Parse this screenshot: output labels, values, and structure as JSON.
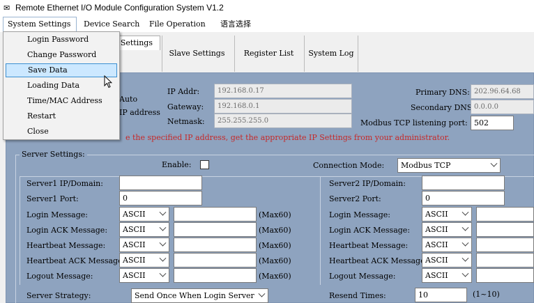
{
  "window": {
    "app_icon": "app-logo-icon",
    "title": "Remote Ethernet I/O Module Configuration System V1.2"
  },
  "menubar": {
    "items": [
      "System Settings",
      "Device Search",
      "File Operation",
      "语言选择"
    ]
  },
  "dropdown": {
    "items": [
      "Login Password",
      "Change Password",
      "Save Data",
      "Loading Data",
      "Time/MAC Address",
      "Restart",
      "Close"
    ],
    "highlighted": "Save Data"
  },
  "tabs": {
    "items": [
      "Settings",
      "Slave Settings",
      "Register List",
      "System Log"
    ],
    "selected": "Settings"
  },
  "network": {
    "ip_mode_auto": "Auto",
    "ip_mode_fixed": "IP address",
    "ip_addr_label": "IP Addr:",
    "ip_addr": "192.168.0.17",
    "gateway_label": "Gateway:",
    "gateway": "192.168.0.1",
    "netmask_label": "Netmask:",
    "netmask": "255.255.255.0",
    "primary_dns_label": "Primary DNS:",
    "primary_dns": "202.96.64.68",
    "secondary_dns_label": "Secondary DNS:",
    "secondary_dns": "0.0.0.0",
    "tcp_port_label": "Modbus TCP listening port:",
    "tcp_port": "502",
    "notice": "e the specified IP address, get the appropriate IP Settings from your administrator."
  },
  "server_settings": {
    "title": "Server Settings:",
    "enable_label": "Enable:",
    "enable_checked": false,
    "connection_mode_label": "Connection Mode:",
    "connection_mode": "Modbus TCP",
    "server1": {
      "ip_label": "Server1 IP/Domain:",
      "ip": "",
      "port_label": "Server1 Port:",
      "port": "0"
    },
    "server2": {
      "ip_label": "Server2 IP/Domain:",
      "ip": "",
      "port_label": "Server2 Port:",
      "port": "0"
    },
    "messages": [
      {
        "label": "Login Message:",
        "encoding": "ASCII",
        "value": "",
        "max": "(Max60)"
      },
      {
        "label": "Login ACK Message:",
        "encoding": "ASCII",
        "value": "",
        "max": "(Max60)"
      },
      {
        "label": "Heartbeat Message:",
        "encoding": "ASCII",
        "value": "",
        "max": "(Max60)"
      },
      {
        "label": "Heartbeat ACK Message:",
        "encoding": "ASCII",
        "value": "",
        "max": "(Max60)"
      },
      {
        "label": "Logout Message:",
        "encoding": "ASCII",
        "value": "",
        "max": "(Max60)"
      }
    ],
    "strategy_label": "Server Strategy:",
    "strategy": "Send Once When Login Server",
    "resend_label": "Resend Times:",
    "resend_times": "10",
    "resend_range": "(1~10)"
  }
}
